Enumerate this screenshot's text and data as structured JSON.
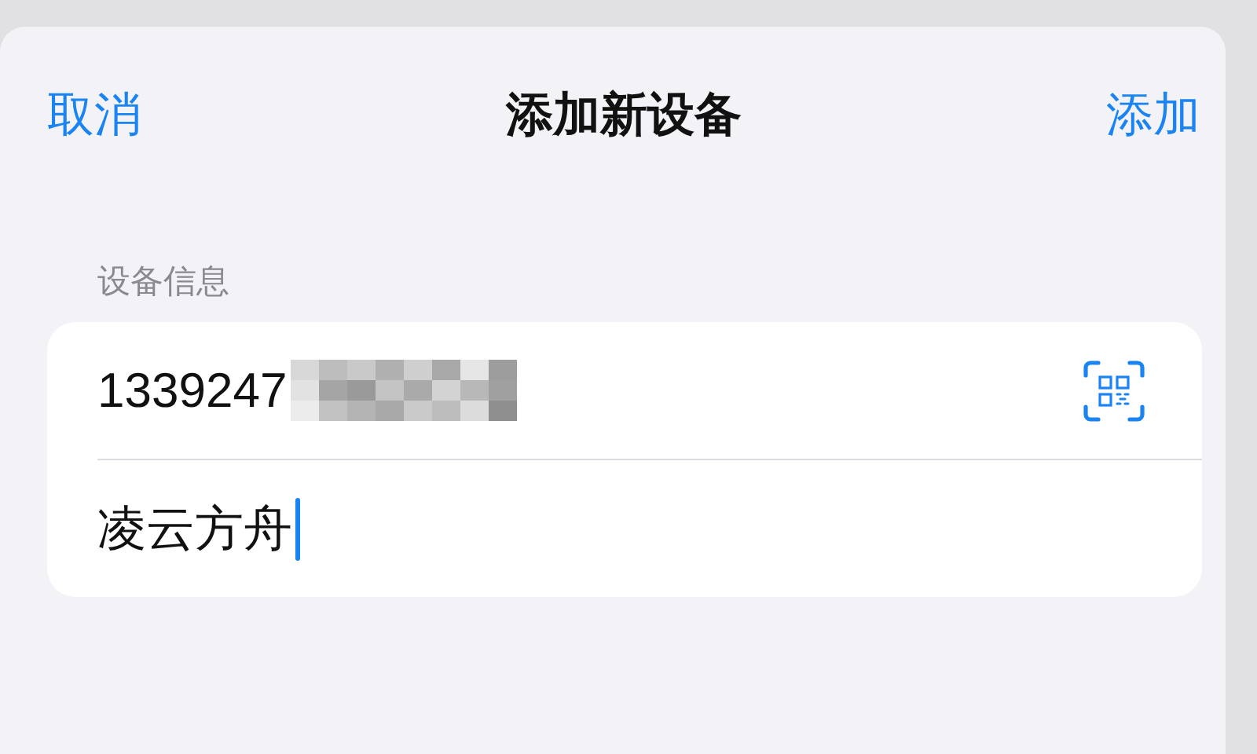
{
  "nav": {
    "cancel": "取消",
    "title": "添加新设备",
    "add": "添加"
  },
  "section": {
    "header": "设备信息",
    "fields": [
      {
        "kind": "scan",
        "value": "1339247",
        "redacted": true,
        "focused": false
      },
      {
        "kind": "text",
        "value": "凌云方舟",
        "redacted": false,
        "focused": true
      }
    ]
  }
}
